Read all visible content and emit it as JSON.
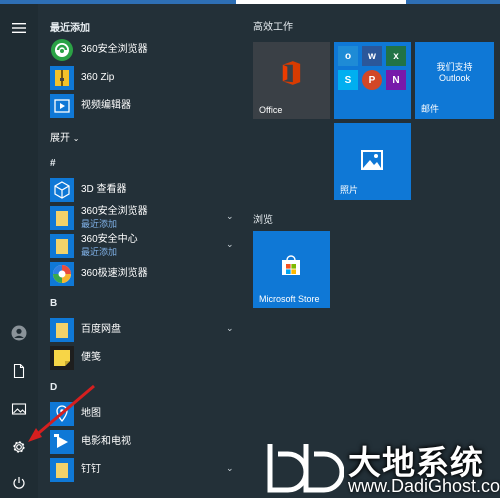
{
  "sections": {
    "recent": "最近添加",
    "expand": "展开",
    "hash": "#",
    "b": "B",
    "d": "D",
    "productive": "高效工作",
    "browse": "浏览"
  },
  "apps": {
    "recent1": "360安全浏览器",
    "recent2": "360 Zip",
    "recent3": "视频编辑器",
    "viewer3d": "3D 查看器",
    "folder360browser": "360安全浏览器",
    "folder360browser_sub": "最近添加",
    "folder360center": "360安全中心",
    "folder360center_sub": "最近添加",
    "speed360": "360极速浏览器",
    "baidu": "百度网盘",
    "sticky": "便笺",
    "maps": "地图",
    "movies": "电影和电视",
    "dingding": "钉钉"
  },
  "tiles": {
    "office": "Office",
    "mail_title": "我们支持",
    "mail_sub": "Outlook",
    "mail": "邮件",
    "photos": "照片",
    "store": "Microsoft Store"
  },
  "watermark": {
    "cn": "大地系统",
    "en": "www.DadiGhost.com"
  },
  "colors": {
    "accent": "#0f78d6",
    "background": "#233038"
  }
}
